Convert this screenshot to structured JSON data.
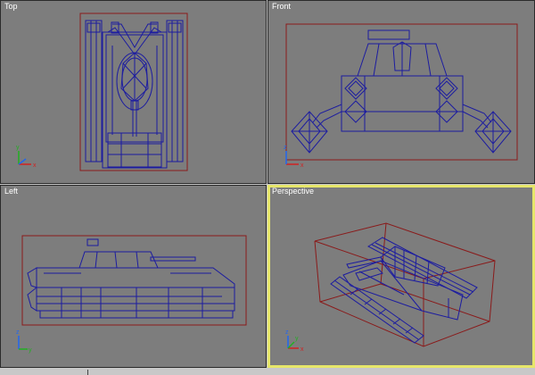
{
  "viewports": {
    "top": {
      "label": "Top"
    },
    "front": {
      "label": "Front"
    },
    "left": {
      "label": "Left"
    },
    "perspective": {
      "label": "Perspective",
      "active": true
    }
  },
  "gizmo_axis_labels": {
    "x": "x",
    "y": "y",
    "z": "z"
  },
  "colors": {
    "viewport_bg": "#7d7d7d",
    "wireframe": "#1c1ca0",
    "bounding_box": "#8a1a1a",
    "active_border": "#e6e66a",
    "axis_x": "#d22222",
    "axis_y": "#22b022",
    "axis_z": "#2266ee"
  }
}
